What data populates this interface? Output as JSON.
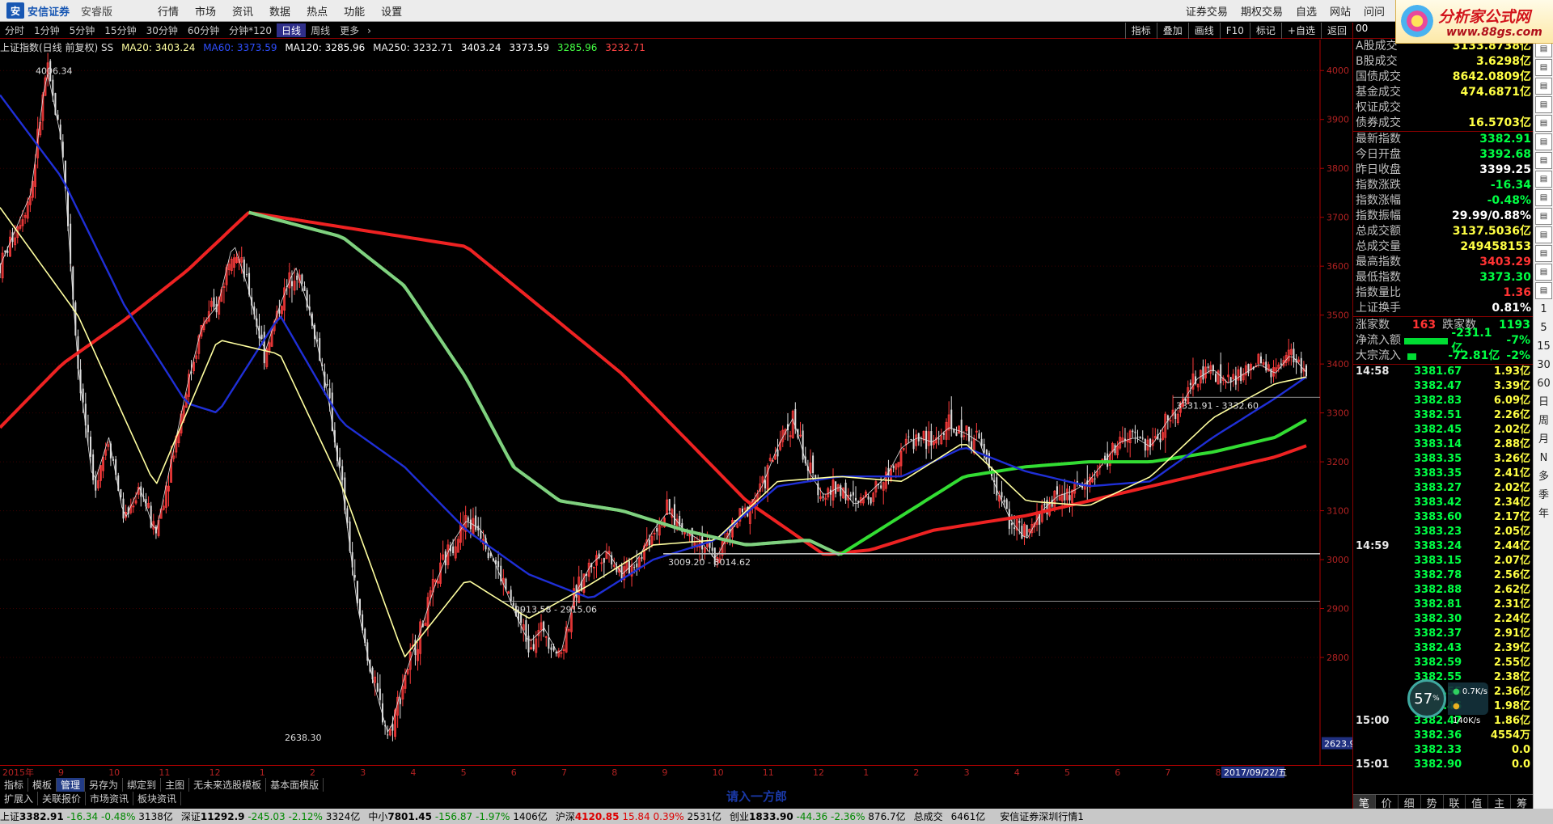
{
  "topbar": {
    "brand": "安信证券",
    "brand_sub": "安睿版",
    "menu": [
      "行情",
      "市场",
      "资讯",
      "数据",
      "热点",
      "功能",
      "设置"
    ],
    "right_menu": [
      "证券交易",
      "期权交易",
      "自选",
      "网站",
      "问问"
    ],
    "ad_title": "分析家公式网",
    "ad_url": "www.88gs.com"
  },
  "periods": [
    "分时",
    "1分钟",
    "5分钟",
    "15分钟",
    "30分钟",
    "60分钟",
    "分钟*120",
    "日线",
    "周线",
    "更多"
  ],
  "active_period": "日线",
  "tools": [
    "指标",
    "叠加",
    "画线",
    "F10",
    "标记",
    "+自选",
    "返回"
  ],
  "ma_header": {
    "title": "上证指数(日线 前复权) SS",
    "ma20": "MA20: 3403.24",
    "ma60": "MA60: 3373.59",
    "ma120": "MA120: 3285.96",
    "ma250": "MA250: 3232.71",
    "v1": "3403.24",
    "v2": "3373.59",
    "v3": "3285.96",
    "v4": "3232.71",
    "colors": {
      "ma20": "#ffffa0",
      "ma60": "#1f2fd6",
      "ma120": "#33dd33",
      "ma250": "#ee2222"
    }
  },
  "chart_data": {
    "type": "candlestick",
    "title": "上证指数(日线 前复权) SS",
    "ylim": [
      2600,
      4050
    ],
    "yticks": [
      2800,
      2900,
      3000,
      3100,
      3200,
      3300,
      3400,
      3500,
      3600,
      3700,
      3800,
      3900,
      4000
    ],
    "x_months": [
      "2015年",
      "9",
      "10",
      "11",
      "12",
      "1",
      "2",
      "3",
      "4",
      "5",
      "6",
      "7",
      "8",
      "9",
      "10",
      "11",
      "12",
      "1",
      "2",
      "3",
      "4",
      "5",
      "6",
      "7",
      "8",
      "9"
    ],
    "last_date_label": "2017/09/22/五",
    "axis_current_value": "2623.9",
    "annotations": [
      {
        "text": "4006.34",
        "price": 4006.34
      },
      {
        "text": "2638.30",
        "price": 2638.3
      },
      {
        "text": "2913.58 - 2915.06",
        "price": 2915
      },
      {
        "text": "3009.20 - 3014.62",
        "price": 3012
      },
      {
        "text": "3331.91 - 3332.60",
        "price": 3332
      }
    ],
    "series": [
      {
        "name": "MA20",
        "color": "#ffffa0"
      },
      {
        "name": "MA60",
        "color": "#1f2fd6"
      },
      {
        "name": "MA120",
        "color": "#33dd33"
      },
      {
        "name": "MA250",
        "color": "#ee2222"
      }
    ],
    "close_path": [
      [
        0,
        3600
      ],
      [
        2,
        3750
      ],
      [
        3,
        4006
      ],
      [
        4,
        3850
      ],
      [
        5,
        3400
      ],
      [
        6,
        3150
      ],
      [
        7,
        3250
      ],
      [
        8,
        3080
      ],
      [
        9,
        3150
      ],
      [
        10,
        3050
      ],
      [
        11,
        3200
      ],
      [
        12,
        3350
      ],
      [
        13,
        3480
      ],
      [
        14,
        3520
      ],
      [
        15,
        3650
      ],
      [
        16,
        3550
      ],
      [
        17,
        3420
      ],
      [
        18,
        3520
      ],
      [
        19,
        3600
      ],
      [
        20,
        3500
      ],
      [
        21,
        3350
      ],
      [
        22,
        3150
      ],
      [
        23,
        2900
      ],
      [
        24,
        2750
      ],
      [
        25,
        2638
      ],
      [
        26,
        2760
      ],
      [
        27,
        2850
      ],
      [
        28,
        2950
      ],
      [
        29,
        3030
      ],
      [
        30,
        3080
      ],
      [
        31,
        3060
      ],
      [
        32,
        2980
      ],
      [
        33,
        2900
      ],
      [
        34,
        2830
      ],
      [
        35,
        2860
      ],
      [
        36,
        2800
      ],
      [
        37,
        2930
      ],
      [
        38,
        2990
      ],
      [
        39,
        3020
      ],
      [
        40,
        2970
      ],
      [
        41,
        3000
      ],
      [
        42,
        3060
      ],
      [
        43,
        3100
      ],
      [
        44,
        3060
      ],
      [
        45,
        3040
      ],
      [
        46,
        3000
      ],
      [
        47,
        3060
      ],
      [
        48,
        3100
      ],
      [
        49,
        3150
      ],
      [
        50,
        3230
      ],
      [
        51,
        3290
      ],
      [
        52,
        3180
      ],
      [
        53,
        3130
      ],
      [
        54,
        3150
      ],
      [
        55,
        3110
      ],
      [
        56,
        3140
      ],
      [
        57,
        3170
      ],
      [
        58,
        3230
      ],
      [
        59,
        3250
      ],
      [
        60,
        3240
      ],
      [
        61,
        3270
      ],
      [
        62,
        3260
      ],
      [
        63,
        3240
      ],
      [
        64,
        3150
      ],
      [
        65,
        3080
      ],
      [
        66,
        3040
      ],
      [
        67,
        3100
      ],
      [
        68,
        3130
      ],
      [
        69,
        3140
      ],
      [
        70,
        3160
      ],
      [
        71,
        3200
      ],
      [
        72,
        3240
      ],
      [
        73,
        3250
      ],
      [
        74,
        3230
      ],
      [
        75,
        3280
      ],
      [
        76,
        3320
      ],
      [
        77,
        3370
      ],
      [
        78,
        3390
      ],
      [
        79,
        3360
      ],
      [
        80,
        3380
      ],
      [
        81,
        3400
      ],
      [
        82,
        3380
      ],
      [
        83,
        3420
      ],
      [
        84,
        3382.91
      ]
    ],
    "ma_paths": {
      "MA20": [
        [
          0,
          3720
        ],
        [
          5,
          3500
        ],
        [
          10,
          3150
        ],
        [
          14,
          3450
        ],
        [
          18,
          3420
        ],
        [
          22,
          3150
        ],
        [
          26,
          2800
        ],
        [
          30,
          2960
        ],
        [
          34,
          2880
        ],
        [
          38,
          2950
        ],
        [
          42,
          3030
        ],
        [
          46,
          3040
        ],
        [
          50,
          3160
        ],
        [
          54,
          3170
        ],
        [
          58,
          3160
        ],
        [
          62,
          3240
        ],
        [
          66,
          3120
        ],
        [
          70,
          3110
        ],
        [
          74,
          3170
        ],
        [
          78,
          3290
        ],
        [
          82,
          3360
        ],
        [
          84,
          3373.59
        ]
      ],
      "MA60": [
        [
          0,
          3950
        ],
        [
          4,
          3780
        ],
        [
          8,
          3520
        ],
        [
          12,
          3320
        ],
        [
          14,
          3300
        ],
        [
          18,
          3500
        ],
        [
          22,
          3280
        ],
        [
          26,
          3190
        ],
        [
          30,
          3060
        ],
        [
          34,
          2970
        ],
        [
          38,
          2920
        ],
        [
          42,
          3000
        ],
        [
          46,
          3040
        ],
        [
          50,
          3150
        ],
        [
          54,
          3170
        ],
        [
          58,
          3170
        ],
        [
          62,
          3230
        ],
        [
          66,
          3180
        ],
        [
          70,
          3150
        ],
        [
          74,
          3160
        ],
        [
          78,
          3250
        ],
        [
          82,
          3330
        ],
        [
          84,
          3373.59
        ]
      ],
      "MA120": [
        [
          16,
          3710
        ],
        [
          22,
          3660
        ],
        [
          26,
          3560
        ],
        [
          30,
          3370
        ],
        [
          33,
          3190
        ],
        [
          36,
          3120
        ],
        [
          40,
          3100
        ],
        [
          44,
          3060
        ],
        [
          48,
          3030
        ],
        [
          52,
          3040
        ],
        [
          54,
          3010
        ],
        [
          58,
          3090
        ],
        [
          62,
          3170
        ],
        [
          66,
          3190
        ],
        [
          70,
          3200
        ],
        [
          74,
          3200
        ],
        [
          78,
          3220
        ],
        [
          82,
          3250
        ],
        [
          84,
          3285.96
        ]
      ],
      "MA250": [
        [
          0,
          3270
        ],
        [
          4,
          3400
        ],
        [
          8,
          3490
        ],
        [
          12,
          3590
        ],
        [
          16,
          3710
        ],
        [
          30,
          3640
        ],
        [
          40,
          3380
        ],
        [
          48,
          3120
        ],
        [
          53,
          3010
        ],
        [
          56,
          3020
        ],
        [
          60,
          3060
        ],
        [
          66,
          3090
        ],
        [
          70,
          3120
        ],
        [
          74,
          3150
        ],
        [
          78,
          3180
        ],
        [
          82,
          3210
        ],
        [
          84,
          3232.71
        ]
      ]
    }
  },
  "bottom_tabs_row1": [
    "指标",
    "模板",
    "管理",
    "另存为",
    "绑定到",
    "主图",
    "无未来选股模板",
    "基本面模版"
  ],
  "bottom_tabs_row2": [
    "扩展入",
    "关联报价",
    "市场资讯",
    "板块资讯"
  ],
  "bottom_period_label": "日线",
  "author_text": "请入一方郎",
  "statusbar": [
    {
      "name": "上证",
      "price": "3382.91",
      "chg": "-16.34",
      "pct": "-0.48%",
      "amt": "3138亿"
    },
    {
      "name": "深证",
      "price": "11292.9",
      "chg": "-245.03",
      "pct": "-2.12%",
      "amt": "3324亿"
    },
    {
      "name": "中小",
      "price": "7801.45",
      "chg": "-156.87",
      "pct": "-1.97%",
      "amt": "1406亿"
    },
    {
      "name": "沪深",
      "price": "4120.85",
      "chg": "15.84",
      "pct": "0.39%",
      "amt": "2531亿"
    },
    {
      "name": "创业",
      "price": "1833.90",
      "chg": "-44.36",
      "pct": "-2.36%",
      "amt": "876.7亿"
    }
  ],
  "status_total_label": "总成交",
  "status_total_value": "6461亿",
  "status_source": "安信证券深圳行情1",
  "right_panel": {
    "header": "00",
    "turnover": [
      {
        "k": "A股成交",
        "v": "3133.8738亿",
        "c": "y"
      },
      {
        "k": "B股成交",
        "v": "3.6298亿",
        "c": "y"
      },
      {
        "k": "国债成交",
        "v": "8642.0809亿",
        "c": "y"
      },
      {
        "k": "基金成交",
        "v": "474.6871亿",
        "c": "y"
      },
      {
        "k": "权证成交",
        "v": "",
        "c": "y"
      },
      {
        "k": "债券成交",
        "v": "16.5703亿",
        "c": "y"
      }
    ],
    "index_stats": [
      {
        "k": "最新指数",
        "v": "3382.91",
        "c": "g"
      },
      {
        "k": "今日开盘",
        "v": "3392.68",
        "c": "g"
      },
      {
        "k": "昨日收盘",
        "v": "3399.25",
        "c": "w"
      },
      {
        "k": "指数涨跌",
        "v": "-16.34",
        "c": "g"
      },
      {
        "k": "指数涨幅",
        "v": "-0.48%",
        "c": "g"
      },
      {
        "k": "指数振幅",
        "v": "29.99/0.88%",
        "c": "w"
      },
      {
        "k": "总成交额",
        "v": "3137.5036亿",
        "c": "y"
      },
      {
        "k": "总成交量",
        "v": "249458153",
        "c": "y"
      },
      {
        "k": "最高指数",
        "v": "3403.29",
        "c": "r"
      },
      {
        "k": "最低指数",
        "v": "3373.30",
        "c": "g"
      },
      {
        "k": "指数量比",
        "v": "1.36",
        "c": "r"
      },
      {
        "k": "上证换手",
        "v": "0.81%",
        "c": "w"
      }
    ],
    "up_label": "涨家数",
    "up_count": "163",
    "down_label": "跌家数",
    "down_count": "1193",
    "flows": [
      {
        "k": "净流入额",
        "v": "-231.1亿",
        "p": "-7%",
        "ratio": 0.9
      },
      {
        "k": "大宗流入",
        "v": "-72.81亿",
        "p": "-2%",
        "ratio": 0.17
      }
    ],
    "ticks": [
      {
        "t": "14:58",
        "p": "3381.67",
        "a": "1.93亿"
      },
      {
        "t": "",
        "p": "3382.47",
        "a": "3.39亿"
      },
      {
        "t": "",
        "p": "3382.83",
        "a": "6.09亿"
      },
      {
        "t": "",
        "p": "3382.51",
        "a": "2.26亿"
      },
      {
        "t": "",
        "p": "3382.45",
        "a": "2.02亿"
      },
      {
        "t": "",
        "p": "3383.14",
        "a": "2.88亿"
      },
      {
        "t": "",
        "p": "3383.35",
        "a": "3.26亿"
      },
      {
        "t": "",
        "p": "3383.35",
        "a": "2.41亿"
      },
      {
        "t": "",
        "p": "3383.27",
        "a": "2.02亿"
      },
      {
        "t": "",
        "p": "3383.42",
        "a": "2.34亿"
      },
      {
        "t": "",
        "p": "3383.60",
        "a": "2.17亿"
      },
      {
        "t": "",
        "p": "3383.23",
        "a": "2.05亿"
      },
      {
        "t": "14:59",
        "p": "3383.24",
        "a": "2.44亿"
      },
      {
        "t": "",
        "p": "3383.15",
        "a": "2.07亿"
      },
      {
        "t": "",
        "p": "3382.78",
        "a": "2.56亿"
      },
      {
        "t": "",
        "p": "3382.88",
        "a": "2.62亿"
      },
      {
        "t": "",
        "p": "3382.81",
        "a": "2.31亿"
      },
      {
        "t": "",
        "p": "3382.30",
        "a": "2.24亿"
      },
      {
        "t": "",
        "p": "3382.37",
        "a": "2.91亿"
      },
      {
        "t": "",
        "p": "3382.43",
        "a": "2.39亿"
      },
      {
        "t": "",
        "p": "3382.59",
        "a": "2.55亿"
      },
      {
        "t": "",
        "p": "3382.55",
        "a": "2.38亿"
      },
      {
        "t": "",
        "p": "3382.55",
        "a": "2.36亿"
      },
      {
        "t": "",
        "p": "3382.46",
        "a": "1.98亿"
      },
      {
        "t": "15:00",
        "p": "3382.47",
        "a": "1.86亿"
      },
      {
        "t": "",
        "p": "3382.36",
        "a": "4554万"
      },
      {
        "t": "",
        "p": "3382.33",
        "a": "0.0"
      },
      {
        "t": "15:01",
        "p": "3382.90",
        "a": "0.0"
      }
    ],
    "bottom_tabs": [
      "笔",
      "价",
      "细",
      "势",
      "联",
      "值",
      "主",
      "筹"
    ]
  },
  "side_text": [
    "日",
    "周",
    "月",
    "N",
    "多",
    "季",
    "年"
  ],
  "side_numbers": [
    "1",
    "5",
    "15",
    "30",
    "60"
  ],
  "speed": {
    "percent": "57",
    "up": "0.7K/s",
    "down": "140K/s"
  }
}
